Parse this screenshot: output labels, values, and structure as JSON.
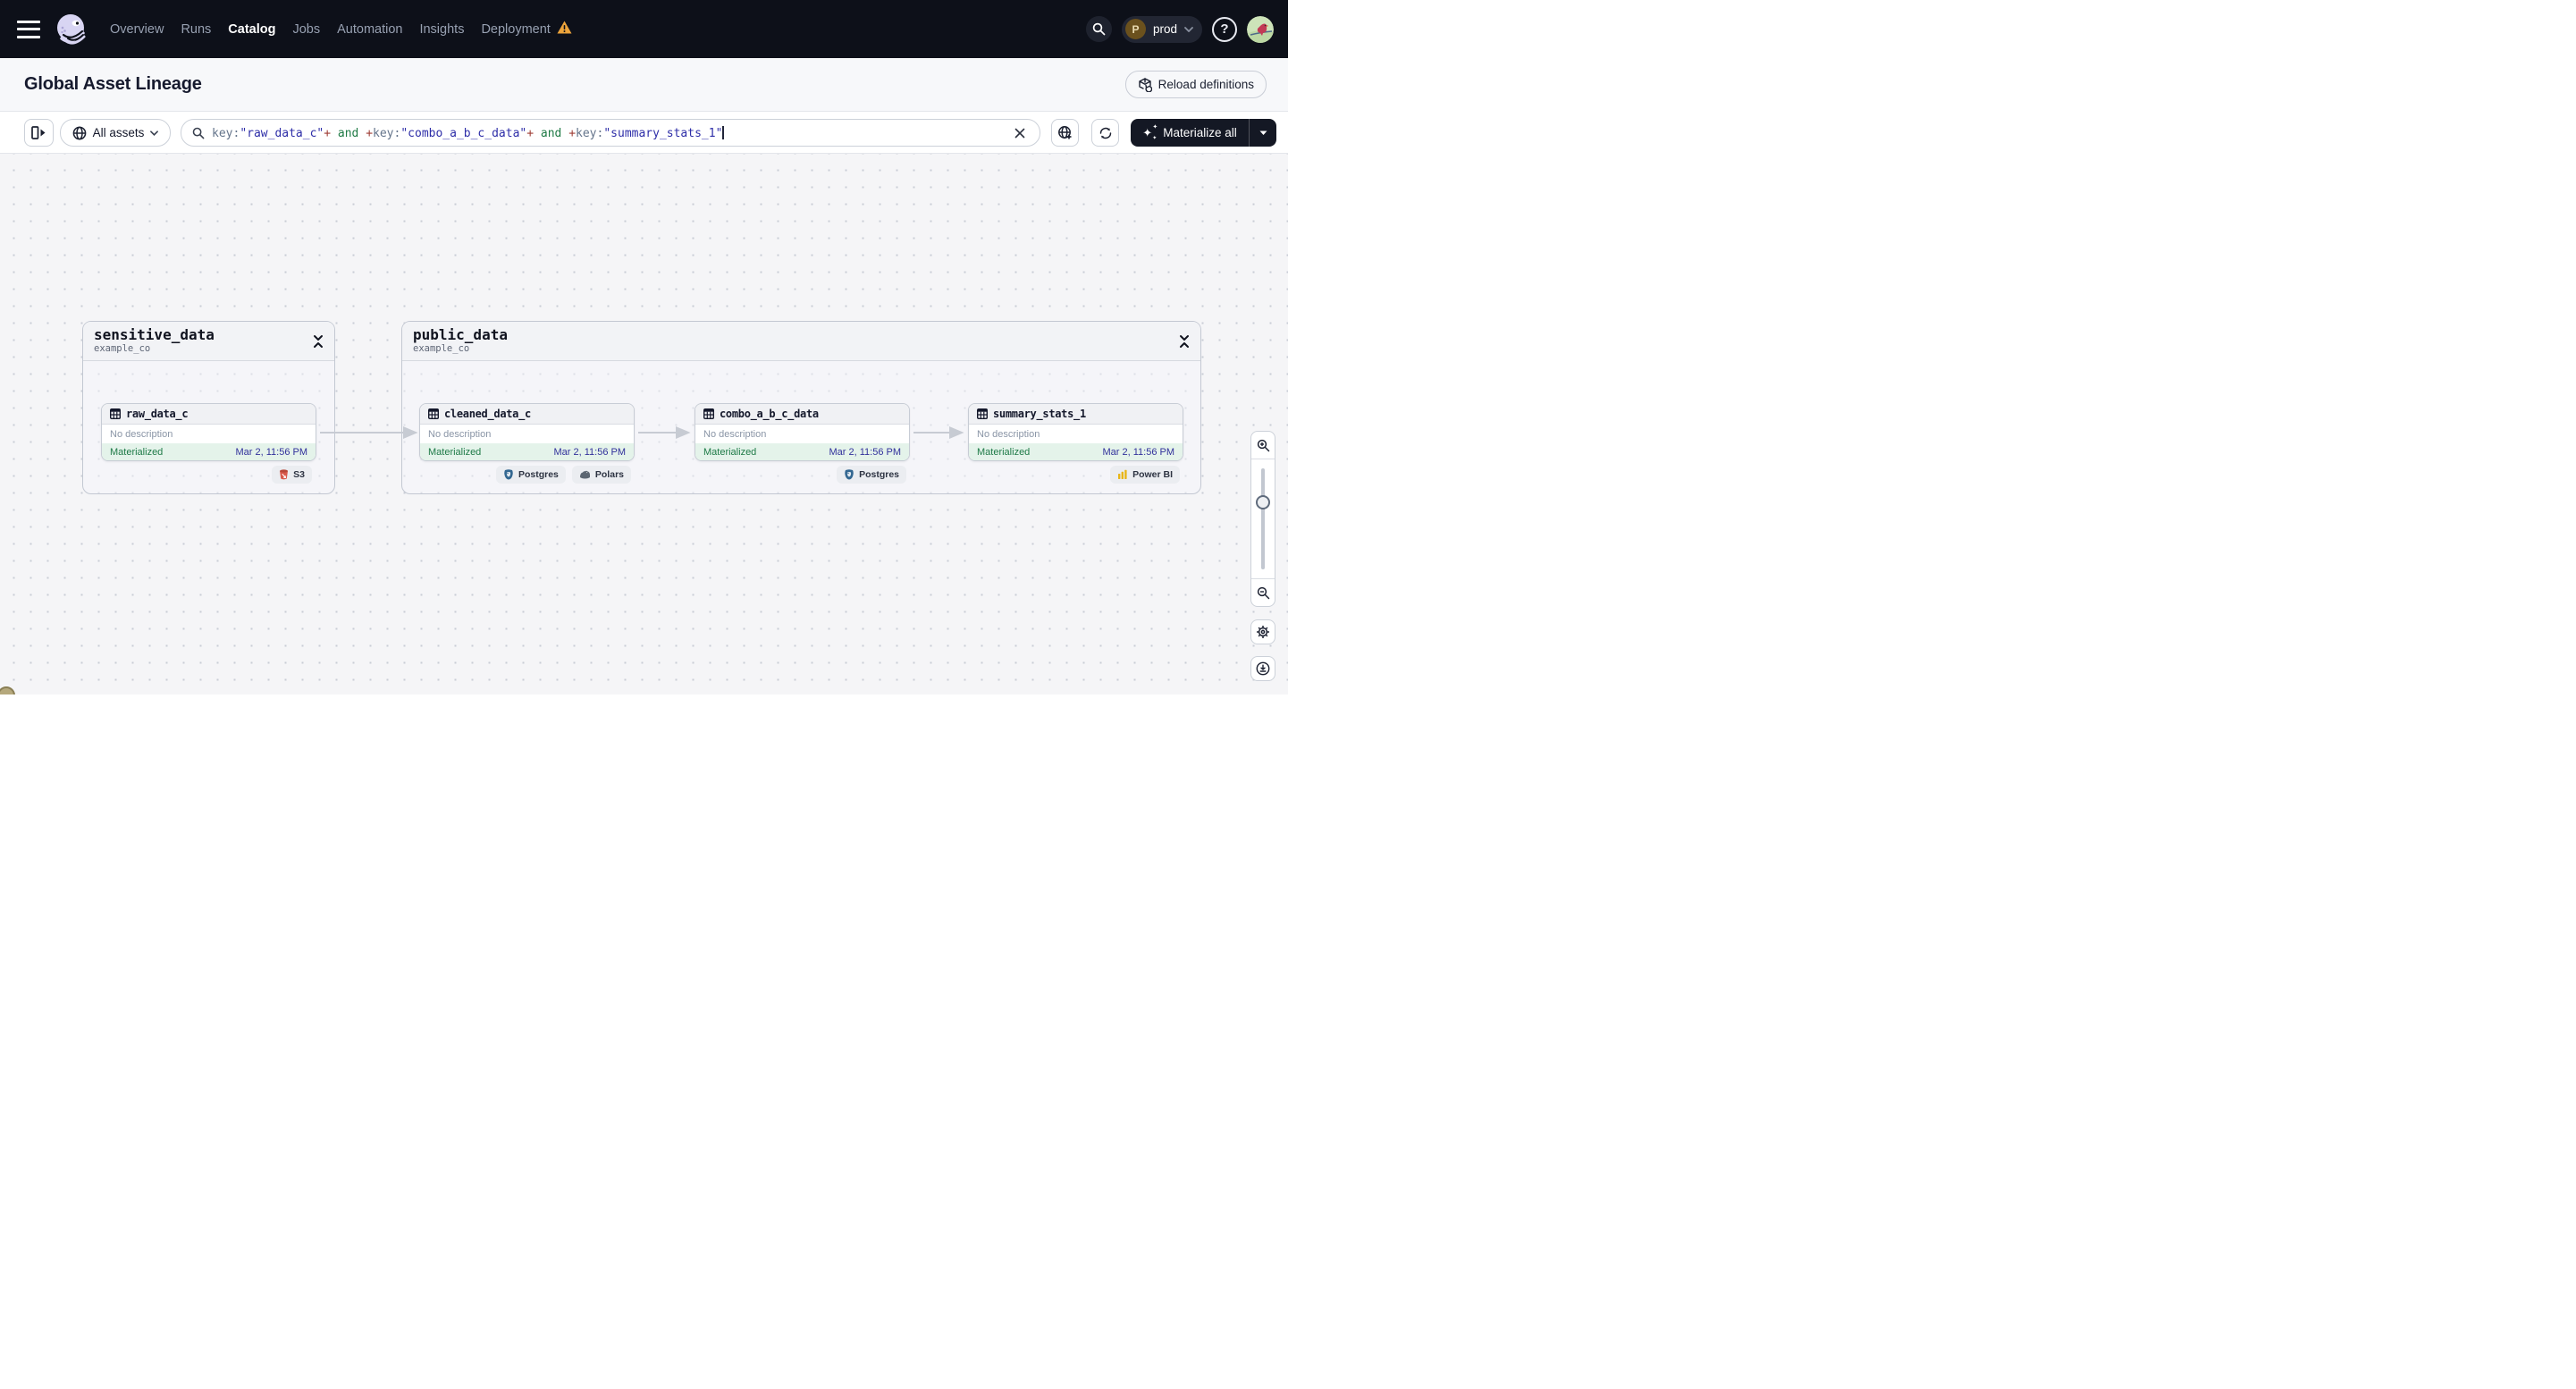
{
  "navbar": {
    "items": [
      {
        "label": "Overview",
        "active": false
      },
      {
        "label": "Runs",
        "active": false
      },
      {
        "label": "Catalog",
        "active": true
      },
      {
        "label": "Jobs",
        "active": false
      },
      {
        "label": "Automation",
        "active": false
      },
      {
        "label": "Insights",
        "active": false
      },
      {
        "label": "Deployment",
        "active": false,
        "warning": true
      }
    ],
    "environment": {
      "initial": "P",
      "name": "prod"
    },
    "help_label": "?"
  },
  "header": {
    "title": "Global Asset Lineage",
    "reload_label": "Reload definitions"
  },
  "toolbar": {
    "filter_label": "All assets",
    "materialize_label": "Materialize all",
    "query_segments": [
      {
        "text": "key:",
        "type": "attr"
      },
      {
        "text": "\"raw_data_c\"",
        "type": "value"
      },
      {
        "text": "+",
        "type": "op"
      },
      {
        "text": " and ",
        "type": "bool"
      },
      {
        "text": "+",
        "type": "op"
      },
      {
        "text": "key:",
        "type": "attr"
      },
      {
        "text": "\"combo_a_b_c_data\"",
        "type": "value"
      },
      {
        "text": "+",
        "type": "op"
      },
      {
        "text": " and ",
        "type": "bool"
      },
      {
        "text": "+",
        "type": "op"
      },
      {
        "text": "key:",
        "type": "attr"
      },
      {
        "text": "\"summary_stats_1\"",
        "type": "value"
      }
    ]
  },
  "graph": {
    "groups": [
      {
        "name": "sensitive_data",
        "subtitle": "example_co",
        "nodes": [
          {
            "name": "raw_data_c",
            "description": "No description",
            "status": "Materialized",
            "timestamp": "Mar 2, 11:56 PM",
            "tags": [
              {
                "label": "S3"
              }
            ]
          }
        ]
      },
      {
        "name": "public_data",
        "subtitle": "example_co",
        "nodes": [
          {
            "name": "cleaned_data_c",
            "description": "No description",
            "status": "Materialized",
            "timestamp": "Mar 2, 11:56 PM",
            "tags": [
              {
                "label": "Postgres"
              },
              {
                "label": "Polars"
              }
            ]
          },
          {
            "name": "combo_a_b_c_data",
            "description": "No description",
            "status": "Materialized",
            "timestamp": "Mar 2, 11:56 PM",
            "tags": [
              {
                "label": "Postgres"
              }
            ]
          },
          {
            "name": "summary_stats_1",
            "description": "No description",
            "status": "Materialized",
            "timestamp": "Mar 2, 11:56 PM",
            "tags": [
              {
                "label": "Power BI"
              }
            ]
          }
        ]
      }
    ]
  },
  "colors": {
    "navbar_bg": "#0d1019",
    "warning": "#eda43b",
    "status_green": "#1e7a47",
    "timestamp_navy": "#31319b",
    "query_value": "#2e2ea8",
    "query_operator": "#9e3b33",
    "query_boolean": "#1f7a45",
    "materialize_button_bg": "#141824",
    "s3_red": "#d9594c",
    "postgres_blue": "#336791",
    "powerbi_yellow": "#e8b517"
  }
}
